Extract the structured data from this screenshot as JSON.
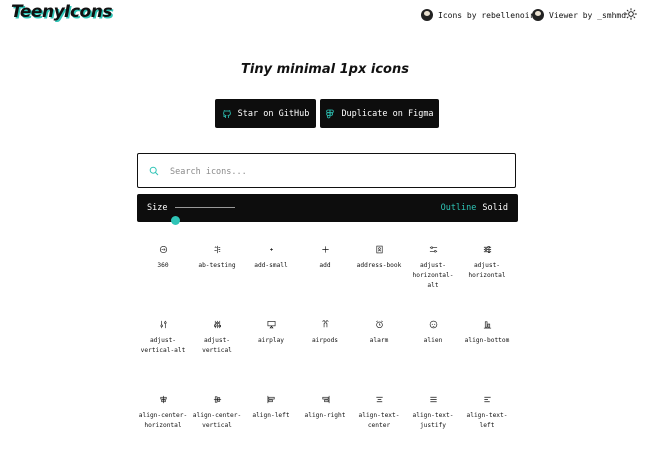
{
  "header": {
    "logo": "TeenyIcons",
    "credits": [
      {
        "text": "Icons by rebellenoire"
      },
      {
        "text": "Viewer by _smhmd"
      }
    ],
    "theme_icon": "sun-icon"
  },
  "hero": {
    "tagline": "Tiny minimal 1px icons",
    "buttons": [
      {
        "label": "Star on GitHub",
        "icon": "github-icon"
      },
      {
        "label": "Duplicate on Figma",
        "icon": "figma-icon"
      }
    ]
  },
  "search": {
    "placeholder": "Search icons...",
    "value": ""
  },
  "controls": {
    "size_label": "Size",
    "size_value_fraction": 0.0,
    "styles": [
      "Outline",
      "Solid"
    ],
    "active_style": "Outline",
    "accent": "#2ec4b6"
  },
  "icons": [
    {
      "label": "360",
      "icon": "360-icon"
    },
    {
      "label": "ab-testing",
      "icon": "ab-testing-icon"
    },
    {
      "label": "add-small",
      "icon": "add-small-icon"
    },
    {
      "label": "add",
      "icon": "add-icon"
    },
    {
      "label": "address-book",
      "icon": "address-book-icon"
    },
    {
      "label": "adjust-\nhorizontal-\nalt",
      "icon": "adjust-horizontal-alt-icon"
    },
    {
      "label": "adjust-\nhorizontal",
      "icon": "adjust-horizontal-icon"
    },
    {
      "label": "adjust-\nvertical-alt",
      "icon": "adjust-vertical-alt-icon"
    },
    {
      "label": "adjust-\nvertical",
      "icon": "adjust-vertical-icon"
    },
    {
      "label": "airplay",
      "icon": "airplay-icon"
    },
    {
      "label": "airpods",
      "icon": "airpods-icon"
    },
    {
      "label": "alarm",
      "icon": "alarm-icon"
    },
    {
      "label": "alien",
      "icon": "alien-icon"
    },
    {
      "label": "align-bottom",
      "icon": "align-bottom-icon"
    },
    {
      "label": "align-center-\nhorizontal",
      "icon": "align-center-horizontal-icon"
    },
    {
      "label": "align-center-\nvertical",
      "icon": "align-center-vertical-icon"
    },
    {
      "label": "align-left",
      "icon": "align-left-icon"
    },
    {
      "label": "align-right",
      "icon": "align-right-icon"
    },
    {
      "label": "align-text-\ncenter",
      "icon": "align-text-center-icon"
    },
    {
      "label": "align-text-\njustify",
      "icon": "align-text-justify-icon"
    },
    {
      "label": "align-text-\nleft",
      "icon": "align-text-left-icon"
    }
  ]
}
